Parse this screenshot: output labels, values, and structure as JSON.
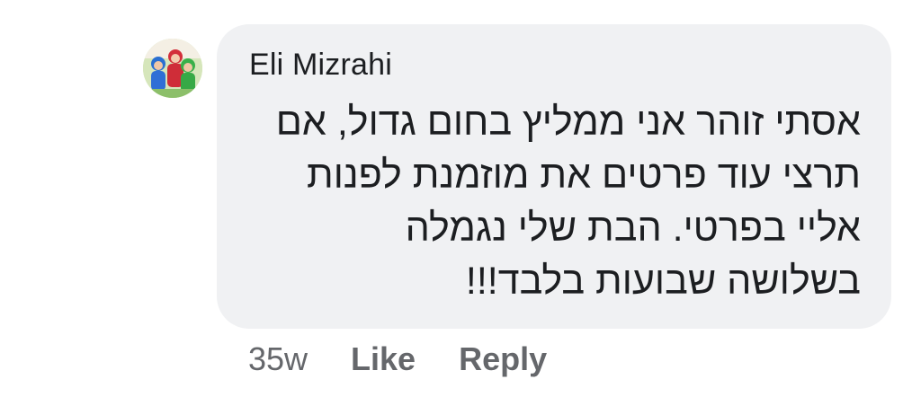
{
  "comment": {
    "author": "Eli Mizrahi",
    "avatar_icon": "user-avatar-photo",
    "text_lines": [
      "אסתי זוהר אני ממליץ בחום גדול, אם",
      "תרצי עוד פרטים את מוזמנת לפנות",
      "אליי בפרטי. הבת שלי נגמלה",
      "בשלושה שבועות בלבד!!!"
    ],
    "bubble_color": "#f0f1f3",
    "text_color": "#1c1e21"
  },
  "actions": {
    "timestamp": "35w",
    "like_label": "Like",
    "reply_label": "Reply",
    "color": "#65676b"
  }
}
